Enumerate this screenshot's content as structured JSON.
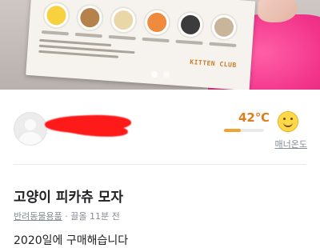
{
  "photo": {
    "card_brand": "KITTEN CLUB",
    "carousel": {
      "total": 2,
      "active_index": 1
    }
  },
  "seller": {
    "manner_temperature": "42℃",
    "manner_temperature_value": 42,
    "manner_label": "매너온도"
  },
  "post": {
    "title": "고양이 피카츄 모자",
    "category": "반려동물용품",
    "separator": " · ",
    "time": "끌올 11분 전",
    "description": "2020일에 구매해습니다"
  },
  "colors": {
    "temperature_orange": "#de7d1f",
    "redaction_red": "#ff1a1a",
    "meta_gray": "#868b94"
  }
}
